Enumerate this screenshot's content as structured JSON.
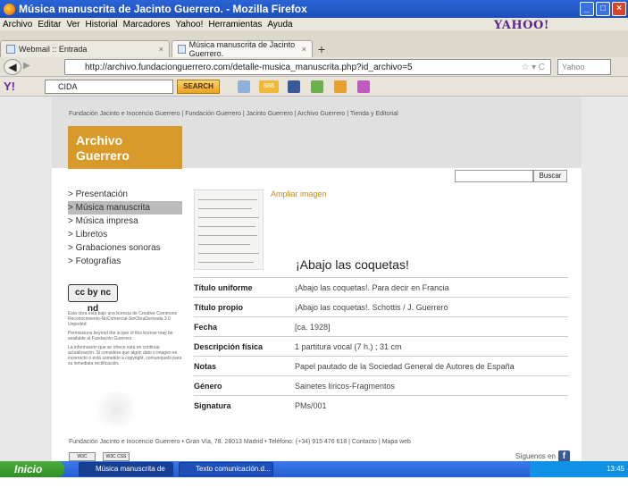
{
  "browser": {
    "window_title": "Música manuscrita de Jacinto Guerrero. - Mozilla Firefox",
    "menu": [
      "Archivo",
      "Editar",
      "Ver",
      "Historial",
      "Marcadores",
      "Yahoo!",
      "Herramientas",
      "Ayuda"
    ],
    "yahoo_logo": "YAHOO!",
    "tabs": [
      {
        "label": "Webmail :: Entrada"
      },
      {
        "label": "Música manuscrita de Jacinto Guerrero."
      }
    ],
    "new_tab": "+",
    "url": "http://archivo.fundacionguerrero.com/detalle-musica_manuscrita.php?id_archivo=5",
    "search_engine_placeholder": "Yahoo"
  },
  "yahoo_toolbar": {
    "logo": "Y!",
    "search_value": "CIDA",
    "search_button": "SEARCH",
    "mail_badge": "888"
  },
  "site": {
    "top_links": "Fundación Jacinto e Inocencio Guerrero | Fundación Guerrero | Jacinto Guerrero | Archivo Guerrero | Tienda y Editorial",
    "archivo_title_line1": "Archivo",
    "archivo_title_line2": "Guerrero",
    "search_button": "Buscar",
    "nav": [
      {
        "label": "> Presentación",
        "active": false
      },
      {
        "label": "> Música manuscrita",
        "active": true
      },
      {
        "label": "> Música impresa",
        "active": false
      },
      {
        "label": "> Libretos",
        "active": false
      },
      {
        "label": "> Grabaciones sonoras",
        "active": false
      },
      {
        "label": "> Fotografías",
        "active": false
      }
    ],
    "cc_badge": "cc by nc nd",
    "license_p1": "Esta obra está bajo una licencia de Creative Commons Reconocimiento-NoComercial-SinObraDerivada 3.0 Unported",
    "license_p2": "Permissions beyond the scope of this license may be available at Fundación Guerrero.",
    "license_p3": "La información que se ofrece está en continua actualización. Si considera que algún dato o imagen es incorrecto o está sometido a copyright, comuníquelo para su inmediata rectificación.",
    "ampliar_link": "Ampliar imagen",
    "work_title": "¡Abajo las coquetas!",
    "metadata": [
      {
        "key": "Título uniforme",
        "value": "¡Abajo las coquetas!. Para decir en Francia"
      },
      {
        "key": "Título propio",
        "value": "¡Abajo las coquetas!. Schottis / J. Guerrero"
      },
      {
        "key": "Fecha",
        "value": "[ca. 1928]"
      },
      {
        "key": "Descripción física",
        "value": "1 partitura vocal (7 h.) ; 31 cm"
      },
      {
        "key": "Notas",
        "value": "Papel pautado de la Sociedad General de Autores de España"
      },
      {
        "key": "Género",
        "value": "Sainetes líricos-Fragmentos"
      },
      {
        "key": "Signatura",
        "value": "PMs/001"
      }
    ],
    "footer": "Fundación Jacinto e Inocencio Guerrero • Gran Vía, 78. 28013 Madrid • Teléfono: (+34) 915 476 618 | Contacto | Mapa web",
    "validator1": "W3C XHTML 1.0",
    "validator2": "W3C CSS",
    "siguenos": "Síguenos en"
  },
  "taskbar": {
    "start": "Inicio",
    "items": [
      {
        "label": "Música manuscrita de ..."
      },
      {
        "label": "Texto comunicación.d..."
      }
    ],
    "clock": "13:45"
  }
}
